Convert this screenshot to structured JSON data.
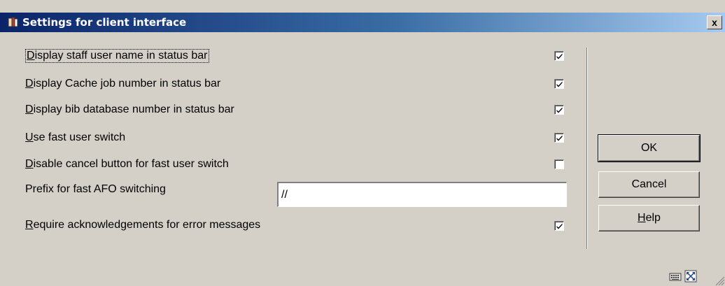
{
  "window": {
    "title": "Settings for client interface",
    "title_icon": "app-icon",
    "close_label": "x"
  },
  "options": [
    {
      "id": "display-staff-user-name",
      "first": "D",
      "rest": "isplay staff user name in status bar",
      "checked": true
    },
    {
      "id": "display-cache-job-number",
      "first": "D",
      "rest": "isplay Cache job number in status bar",
      "checked": true
    },
    {
      "id": "display-bib-database-number",
      "first": "D",
      "rest": "isplay bib database number in status bar",
      "checked": true
    },
    {
      "id": "use-fast-user-switch",
      "first": "U",
      "rest": "se fast user switch",
      "checked": true
    },
    {
      "id": "disable-cancel-button",
      "first": "D",
      "rest": "isable cancel button for fast user switch",
      "checked": false
    },
    {
      "id": "require-acknowledgements",
      "first": "R",
      "rest": "equire acknowledgements for error messages",
      "checked": true
    }
  ],
  "prefix": {
    "label": "Prefix for fast AFO switching",
    "value": "//"
  },
  "buttons": {
    "ok": "OK",
    "cancel": "Cancel",
    "help_mnemonic": "H",
    "help_rest": "elp"
  },
  "status_icons": [
    "keyboard-icon",
    "fullscreen-icon"
  ],
  "colors": {
    "dialog_bg": "#d4d0c8",
    "title_start": "#0a246a",
    "title_end": "#a6caf0"
  }
}
